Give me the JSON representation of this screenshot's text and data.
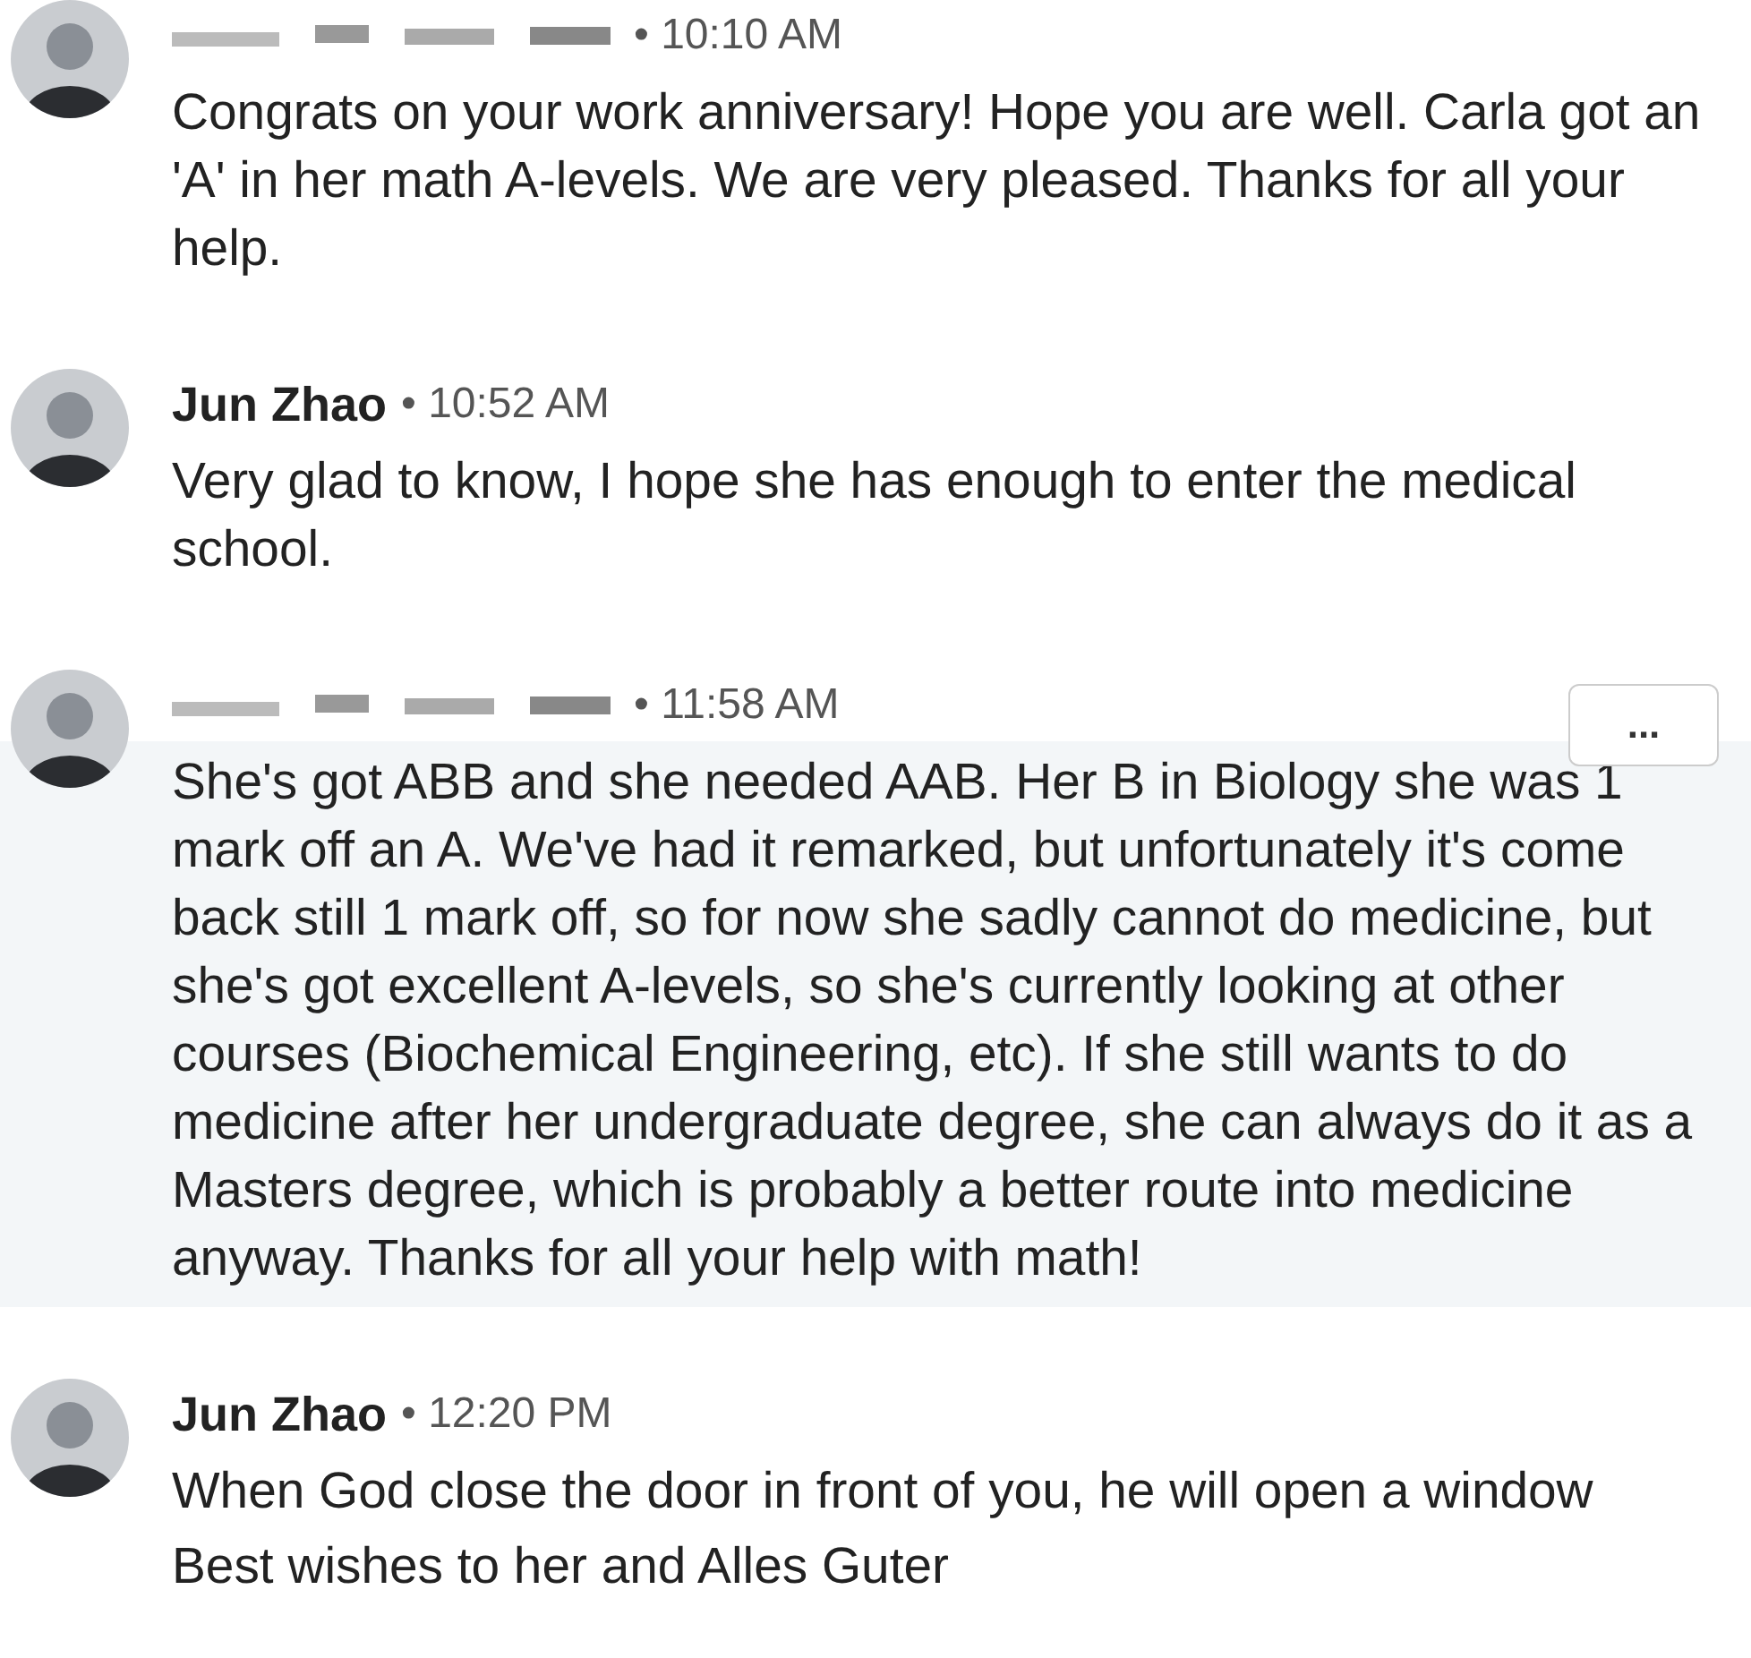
{
  "messages": [
    {
      "name_hidden": true,
      "separator": "•",
      "time": "10:10 AM",
      "highlighted": false,
      "lines": [
        "Congrats on your work anniversary! Hope you are well. Carla got an 'A' in her math A-levels. We are very pleased. Thanks for all your help."
      ]
    },
    {
      "sender": "Jun Zhao",
      "name_hidden": false,
      "separator": "•",
      "time": "10:52 AM",
      "highlighted": false,
      "lines": [
        "Very glad to know, I hope she has enough to enter the medical school."
      ]
    },
    {
      "name_hidden": true,
      "separator": "•",
      "time": "11:58 AM",
      "highlighted": true,
      "more_button": "...",
      "lines": [
        "She's got ABB and she needed AAB. Her B in Biology she was 1 mark off an A. We've had it remarked, but unfortunately it's come back still 1 mark off, so for now she sadly cannot do medicine, but she's got excellent A-levels, so she's currently looking at other courses (Biochemical Engineering, etc). If she still wants to do medicine after her undergraduate degree, she can always do it as a Masters degree, which is probably a better route into medicine anyway. Thanks for all your help with math!"
      ]
    },
    {
      "sender": "Jun Zhao",
      "name_hidden": false,
      "separator": "•",
      "time": "12:20 PM",
      "highlighted": false,
      "lines": [
        "When God close the door in front of you, he will open a window",
        "Best wishes to her and Alles Guter"
      ]
    }
  ]
}
